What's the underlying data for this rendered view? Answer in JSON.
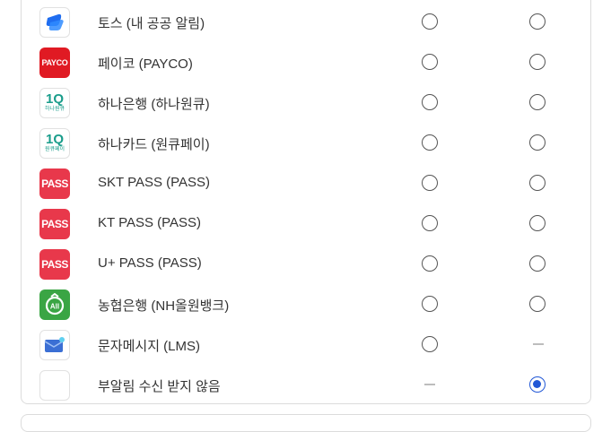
{
  "rows": [
    {
      "label": "토스 (내 공공 알림)",
      "logo": "toss-icon",
      "push": "radio",
      "email": "radio",
      "checked": ""
    },
    {
      "label": "페이코 (PAYCO)",
      "logo_text": "PAYCO",
      "push": "radio",
      "email": "radio",
      "checked": ""
    },
    {
      "label": "하나은행 (하나원큐)",
      "logo_text": "1Q",
      "logo_sub": "하나원큐",
      "push": "radio",
      "email": "radio",
      "checked": ""
    },
    {
      "label": "하나카드 (원큐페이)",
      "logo_text": "1Q",
      "logo_sub": "원큐페이",
      "push": "radio",
      "email": "radio",
      "checked": ""
    },
    {
      "label": "SKT PASS (PASS)",
      "logo_text": "PASS",
      "push": "radio",
      "email": "radio",
      "checked": ""
    },
    {
      "label": "KT PASS (PASS)",
      "logo_text": "PASS",
      "push": "radio",
      "email": "radio",
      "checked": ""
    },
    {
      "label": "U+ PASS (PASS)",
      "logo_text": "PASS",
      "push": "radio",
      "email": "radio",
      "checked": ""
    },
    {
      "label": "농협은행 (NH올원뱅크)",
      "logo": "nh-allone-icon",
      "push": "radio",
      "email": "radio",
      "checked": ""
    },
    {
      "label": "문자메시지 (LMS)",
      "logo": "mail-icon",
      "push": "radio",
      "email": "dash",
      "checked": ""
    },
    {
      "label": "부알림 수신 받지 않음",
      "logo": "blank-icon",
      "push": "dash",
      "email": "radio",
      "checked": "email"
    }
  ],
  "colors": {
    "accent": "#2157d6",
    "pass": "#e8384b",
    "payco": "#e01a23",
    "nh": "#3aa544",
    "toss": "#1f6df0"
  }
}
